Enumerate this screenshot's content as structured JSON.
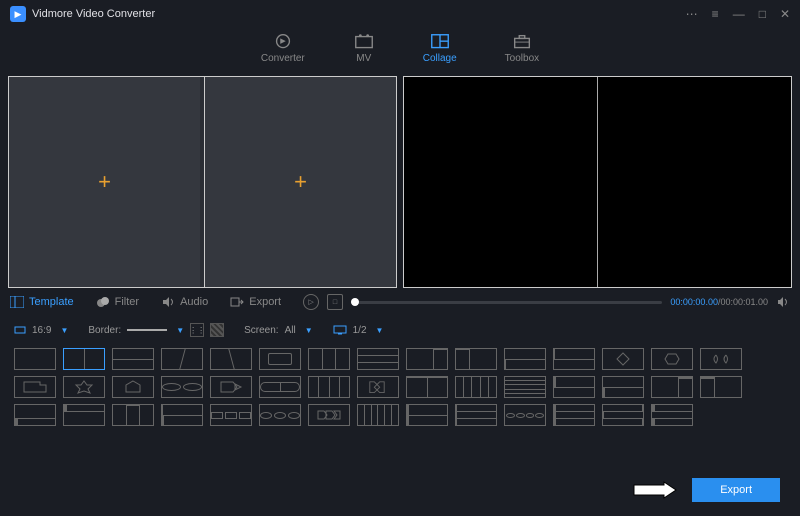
{
  "app": {
    "title": "Vidmore Video Converter"
  },
  "nav": {
    "converter": "Converter",
    "mv": "MV",
    "collage": "Collage",
    "toolbox": "Toolbox"
  },
  "midtabs": {
    "template": "Template",
    "filter": "Filter",
    "audio": "Audio",
    "export": "Export"
  },
  "player": {
    "pos": "00:00:00.00",
    "dur": "/00:00:01.00"
  },
  "options": {
    "ratio": "16:9",
    "borderLabel": "Border:",
    "screenLabel": "Screen:",
    "screenValue": "All",
    "pageValue": "1/2"
  },
  "footer": {
    "export": "Export"
  }
}
